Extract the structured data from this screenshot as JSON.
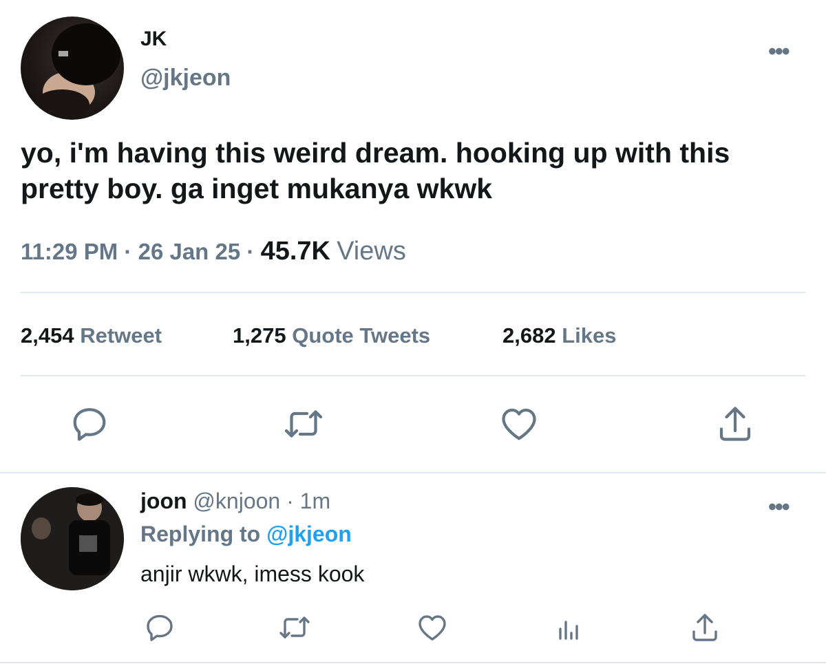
{
  "tweet": {
    "display_name": "JK",
    "handle": "@jkjeon",
    "text": "yo, i'm having this weird dream. hooking up with this pretty boy. ga inget mukanya wkwk",
    "time": "11:29 PM",
    "date": "26 Jan 25",
    "views_count": "45.7K",
    "views_label": "Views",
    "more_label": "•••",
    "stats": {
      "retweets_count": "2,454",
      "retweets_label": "Retweet",
      "quotes_count": "1,275",
      "quotes_label": "Quote Tweets",
      "likes_count": "2,682",
      "likes_label": "Likes"
    },
    "actions": [
      "reply-icon",
      "retweet-icon",
      "like-icon",
      "share-icon"
    ]
  },
  "reply": {
    "display_name": "joon",
    "handle": "@knjoon",
    "age": "· 1m",
    "replying_prefix": "Replying to",
    "replying_to": "@jkjeon",
    "text": "anjir wkwk, imess kook",
    "more_label": "•••",
    "actions": [
      "reply-icon",
      "retweet-icon",
      "like-icon",
      "analytics-icon",
      "share-icon"
    ]
  },
  "colors": {
    "text_primary": "#14171a",
    "text_secondary": "#657786",
    "link": "#1da1f2",
    "divider": "#e1e8ed"
  }
}
